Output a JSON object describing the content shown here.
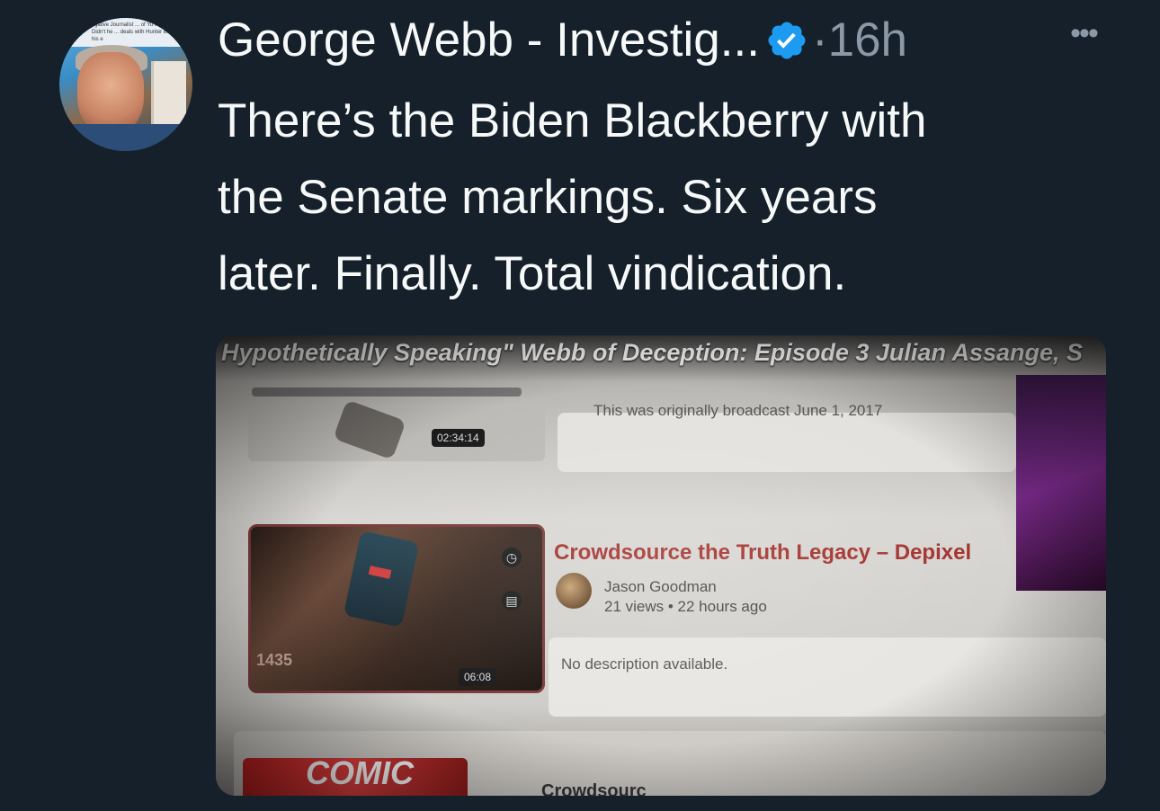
{
  "author": {
    "name": "George Webb - Investig...",
    "separator": "·",
    "time": "16h",
    "verified_icon": "verified-badge-icon",
    "avatar_banner_text": "tigative Journalist ... of Yu to Trump? Didn't he ... deals with Hunter Biden with his e"
  },
  "more_icon": "more-horizontal-icon",
  "tweet": {
    "lines": [
      "There’s the Biden Blackberry with",
      "the Senate markings. Six years",
      "later. Finally. Total vindication."
    ]
  },
  "media": {
    "video_title": "Hypothetically Speaking\" Webb of Deception: Episode 3 Julian Assange, S",
    "broadcast_note": "This was originally broadcast June 1, 2017",
    "timestamp_1": "02:34:14",
    "timestamp_2": "06:08",
    "thumb_badge": "1435",
    "video2_title": "Crowdsource the Truth Legacy – Depixel",
    "channel_name": "Jason Goodman",
    "channel_meta": "21 views • 22 hours ago",
    "description": "No description available.",
    "thumb3_text": "COMIC",
    "video3_title_partial": "Crowdsourc"
  },
  "colors": {
    "background": "#15202b",
    "text_primary": "#f7f9f9",
    "text_secondary": "#8b98a5",
    "verified": "#1d9bf0",
    "video_title_red": "#a3312c"
  }
}
